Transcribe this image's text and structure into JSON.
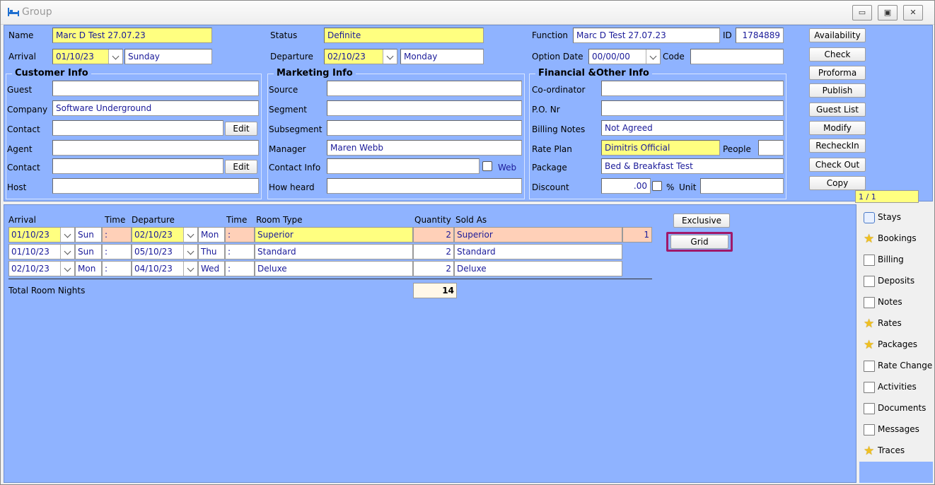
{
  "window": {
    "title": "Group"
  },
  "header": {
    "name_label": "Name",
    "name_value": "Marc D Test 27.07.23",
    "status_label": "Status",
    "status_value": "Definite",
    "function_label": "Function",
    "function_value": "Marc D Test 27.07.23",
    "id_label": "ID",
    "id_value": "1784889",
    "arrival_label": "Arrival",
    "arrival_date": "01/10/23",
    "arrival_day": "Sunday",
    "departure_label": "Departure",
    "departure_date": "02/10/23",
    "departure_day": "Monday",
    "option_date_label": "Option Date",
    "option_date_value": "00/00/00",
    "code_label": "Code",
    "code_value": ""
  },
  "customer_info": {
    "title": "Customer Info",
    "guest_label": "Guest",
    "guest_value": "",
    "company_label": "Company",
    "company_value": "Software Underground",
    "contact_label": "Contact",
    "contact_value": "",
    "contact_edit": "Edit",
    "agent_label": "Agent",
    "agent_value": "",
    "agent_contact_label": "Contact",
    "agent_contact_value": "",
    "agent_contact_edit": "Edit",
    "host_label": "Host",
    "host_value": ""
  },
  "marketing_info": {
    "title": "Marketing Info",
    "source_label": "Source",
    "source_value": "",
    "segment_label": "Segment",
    "segment_value": "",
    "subsegment_label": "Subsegment",
    "subsegment_value": "",
    "manager_label": "Manager",
    "manager_value": "Maren  Webb",
    "contact_info_label": "Contact Info",
    "contact_info_value": "",
    "web_label": "Web",
    "how_heard_label": "How heard",
    "how_heard_value": ""
  },
  "financial_info": {
    "title": "Financial &Other Info",
    "coordinator_label": "Co-ordinator",
    "coordinator_value": "",
    "po_label": "P.O. Nr",
    "po_value": "",
    "billing_notes_label": "Billing Notes",
    "billing_notes_value": "Not Agreed",
    "rate_plan_label": "Rate Plan",
    "rate_plan_value": "Dimitris Official",
    "people_label": "People",
    "people_value": "",
    "package_label": "Package",
    "package_value": "Bed & Breakfast Test",
    "discount_label": "Discount",
    "discount_value": ".00",
    "percent_label": "%",
    "unit_label": "Unit",
    "unit_value": ""
  },
  "actions": [
    "Availability",
    "Check",
    "Proforma",
    "Publish",
    "Guest List",
    "Modify",
    "RecheckIn",
    "Check Out",
    "Copy"
  ],
  "pager": "1 / 1",
  "rooms": {
    "headers": {
      "arrival": "Arrival",
      "time1": "Time",
      "departure": "Departure",
      "time2": "Time",
      "room_type": "Room Type",
      "quantity": "Quantity",
      "sold_as": "Sold As"
    },
    "rows": [
      {
        "arrival": "01/10/23",
        "arr_day": "Sun",
        "time1": ":",
        "departure": "02/10/23",
        "dep_day": "Mon",
        "time2": ":",
        "room_type": "Superior",
        "quantity": "2",
        "sold_as": "Superior",
        "extra": "1"
      },
      {
        "arrival": "01/10/23",
        "arr_day": "Sun",
        "time1": ":",
        "departure": "05/10/23",
        "dep_day": "Thu",
        "time2": ":",
        "room_type": "Standard",
        "quantity": "2",
        "sold_as": "Standard",
        "extra": ""
      },
      {
        "arrival": "02/10/23",
        "arr_day": "Mon",
        "time1": ":",
        "departure": "04/10/23",
        "dep_day": "Wed",
        "time2": ":",
        "room_type": "Deluxe",
        "quantity": "2",
        "sold_as": "Deluxe",
        "extra": ""
      }
    ],
    "total_label": "Total Room Nights",
    "total_value": "14",
    "exclusive_label": "Exclusive",
    "grid_label": "Grid"
  },
  "sidebar": [
    {
      "label": "Stays",
      "icon": "chat-icon"
    },
    {
      "label": "Bookings",
      "icon": "star-icon"
    },
    {
      "label": "Billing",
      "icon": "document-icon"
    },
    {
      "label": "Deposits",
      "icon": "document-icon"
    },
    {
      "label": "Notes",
      "icon": "document-icon"
    },
    {
      "label": "Rates",
      "icon": "star-icon"
    },
    {
      "label": "Packages",
      "icon": "star-icon"
    },
    {
      "label": "Rate Change",
      "icon": "document-icon"
    },
    {
      "label": "Activities",
      "icon": "document-icon"
    },
    {
      "label": "Documents",
      "icon": "document-icon"
    },
    {
      "label": "Messages",
      "icon": "document-icon"
    },
    {
      "label": "Traces",
      "icon": "star-icon"
    }
  ],
  "colors": {
    "panel": "#8fb3ff",
    "required": "#ffff80",
    "highlight": "#ffd0b8",
    "grid_outline": "#a0186a",
    "value_text": "#1a1a99"
  }
}
